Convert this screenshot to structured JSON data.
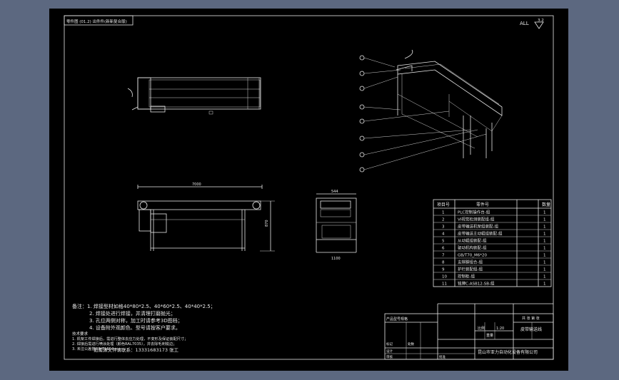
{
  "title_strip": "零件图 (01.2) 出件件(新新复合版)",
  "finish_mark": "ALL",
  "finish_value": "3.2",
  "dims": {
    "front_width": "7000",
    "front_height": "870",
    "side_top": "544",
    "side_bottom": "1100"
  },
  "balloons": [
    "1",
    "2",
    "3",
    "4",
    "5",
    "6",
    "7"
  ],
  "bom": {
    "headers": [
      "项目号",
      "零件号",
      "",
      "数量"
    ],
    "rows": [
      {
        "no": "1",
        "part": "PLC控制操作台-组",
        "spec": "",
        "qty": "1"
      },
      {
        "no": "2",
        "part": "VI视觉检测装配组-组",
        "spec": "",
        "qty": "1"
      },
      {
        "no": "3",
        "part": "皮带输送机架组装配-组",
        "spec": "",
        "qty": "1"
      },
      {
        "no": "4",
        "part": "皮带输送主动辊组装配-组",
        "spec": "",
        "qty": "1"
      },
      {
        "no": "5",
        "part": "从动辊组装配-组",
        "spec": "",
        "qty": "1"
      },
      {
        "no": "6",
        "part": "驱动机构装配-组",
        "spec": "",
        "qty": "1"
      },
      {
        "no": "7",
        "part": "GB/T70_M6*20",
        "spec": "",
        "qty": "1"
      },
      {
        "no": "8",
        "part": "支撑脚组合-组",
        "spec": "",
        "qty": "1"
      },
      {
        "no": "9",
        "part": "护栏装配组-组",
        "spec": "",
        "qty": "1"
      },
      {
        "no": "10",
        "part": "控制柜-组",
        "spec": "",
        "qty": "1"
      },
      {
        "no": "11",
        "part": "铭牌C-ASB12-SB-组",
        "spec": "",
        "qty": "1"
      }
    ]
  },
  "notes": {
    "lines": [
      "备注：1. 焊接型材如格40*80*2.5、40*60*2.5、40*40*2.5；",
      "2. 焊接处进行焊接，并清理打磨抛光；",
      "3. 孔位两侧对称，加工时请参考3D图档；",
      "4. 设备附外观颜色、型号请按客户要求。"
    ],
    "tech_title": "技术要求",
    "tech_lines": [
      "1. 机架工件焊接后，需进行整体去应力处理，不变形及保证装配尺寸；",
      "2. 焊接后需进行喷涂处理（颜色RAL7035），并去除毛刺锐边；",
      "3. 未注公差按GB/T1804-m。"
    ],
    "contact": "如需源文件请联系：13331683173  张工"
  },
  "title_block": {
    "company": "昆山市亚力自动化设备有限公司",
    "drawing_name": "皮带输送线",
    "scale_label": "比例",
    "scale": "1:20",
    "weight_label": "重量",
    "sheet_label": "共 张 第 张",
    "left_label": "产品型号规格",
    "cells": [
      "标记",
      "处数",
      "分区",
      "更改文件号",
      "签名",
      "年月日",
      "设计",
      "标准化",
      "审核",
      "工艺",
      "批准"
    ]
  }
}
